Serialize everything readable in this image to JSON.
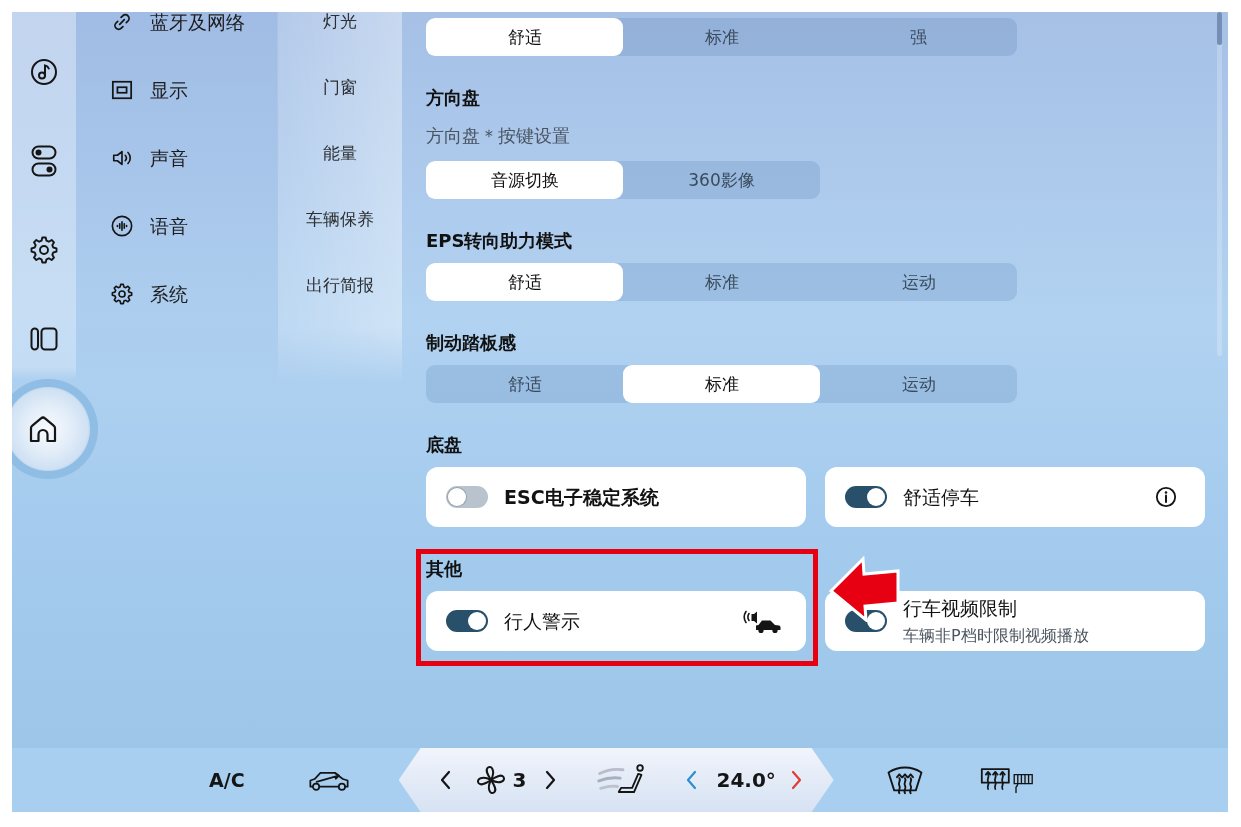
{
  "rail": {
    "items": [
      {
        "kind": "music",
        "selected": false
      },
      {
        "kind": "switches",
        "selected": false
      },
      {
        "kind": "settings",
        "selected": false
      },
      {
        "kind": "panels",
        "selected": false
      },
      {
        "kind": "home",
        "selected": true
      }
    ]
  },
  "menu": {
    "items": [
      {
        "kind": "link",
        "label": "蓝牙及网络",
        "selected": false
      },
      {
        "kind": "display",
        "label": "显示",
        "selected": false
      },
      {
        "kind": "sound",
        "label": "声音",
        "selected": false
      },
      {
        "kind": "voice",
        "label": "语音",
        "selected": false
      },
      {
        "kind": "system",
        "label": "系统",
        "selected": false
      }
    ]
  },
  "submenu": {
    "items": [
      {
        "label": "灯光",
        "selected": false
      },
      {
        "label": "门窗",
        "selected": false
      },
      {
        "label": "能量",
        "selected": false
      },
      {
        "label": "车辆保养",
        "selected": false
      },
      {
        "label": "出行简报",
        "selected": false
      }
    ]
  },
  "sections": [
    {
      "options": [
        {
          "label": "舒适",
          "selected": true
        },
        {
          "label": "标准",
          "selected": false
        },
        {
          "label": "强",
          "selected": false
        }
      ]
    },
    {
      "title": "方向盘",
      "subtitle": "方向盘＊按键设置",
      "options": [
        {
          "label": "音源切换",
          "selected": true
        },
        {
          "label": "360影像",
          "selected": false
        }
      ]
    },
    {
      "title": "EPS转向助力模式",
      "options": [
        {
          "label": "舒适",
          "selected": true
        },
        {
          "label": "标准",
          "selected": false
        },
        {
          "label": "运动",
          "selected": false
        }
      ]
    },
    {
      "title": "制动踏板感",
      "options": [
        {
          "label": "舒适",
          "selected": false
        },
        {
          "label": "标准",
          "selected": true
        },
        {
          "label": "运动",
          "selected": false
        }
      ]
    },
    {
      "title": "底盘",
      "cards": [
        {
          "kind": "plain",
          "label": "ESC电子稳定系统",
          "bold": true,
          "on": false
        },
        {
          "kind": "info",
          "label": "舒适停车",
          "bold": false,
          "on": true
        }
      ]
    },
    {
      "title": "其他",
      "highlight": true,
      "cards": [
        {
          "kind": "alert",
          "label": "行人警示",
          "bold": false,
          "on": true
        },
        {
          "kind": "plain",
          "label": "行车视频限制",
          "subtitle": "车辆非P档时限制视频播放",
          "bold": false,
          "on": true
        }
      ]
    }
  ],
  "climate": {
    "ac_label": "A/C",
    "fan_speed": "3",
    "temperature": "24.0°"
  }
}
